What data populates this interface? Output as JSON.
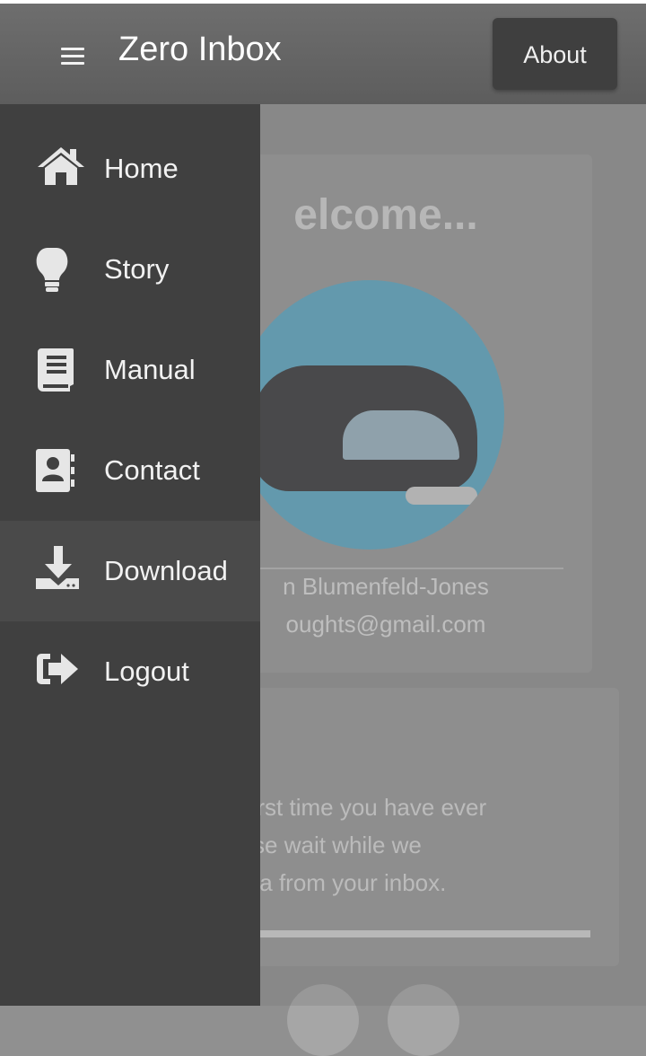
{
  "app": {
    "title": "Zero Inbox",
    "about_label": "About"
  },
  "welcome_card": {
    "heading": "elcome...",
    "name": "n Blumenfeld-Jones",
    "email": "oughts@gmail.com"
  },
  "status_card": {
    "lines": [
      "the first time you have ever",
      "Please wait while we",
      "a-data from your inbox."
    ],
    "progress": 1.0
  },
  "drawer": {
    "items": [
      {
        "label": "Home",
        "icon": "home-icon"
      },
      {
        "label": "Story",
        "icon": "lightbulb-icon"
      },
      {
        "label": "Manual",
        "icon": "book-icon"
      },
      {
        "label": "Contact",
        "icon": "contact-book-icon"
      },
      {
        "label": "Download",
        "icon": "download-icon",
        "active": true
      },
      {
        "label": "Logout",
        "icon": "logout-icon"
      }
    ]
  },
  "colors": {
    "drawer_bg": "#404040",
    "drawer_active_bg": "#4a4a4a",
    "appbar_bg": "#626262",
    "avatar_bg": "#5fa7c2"
  }
}
